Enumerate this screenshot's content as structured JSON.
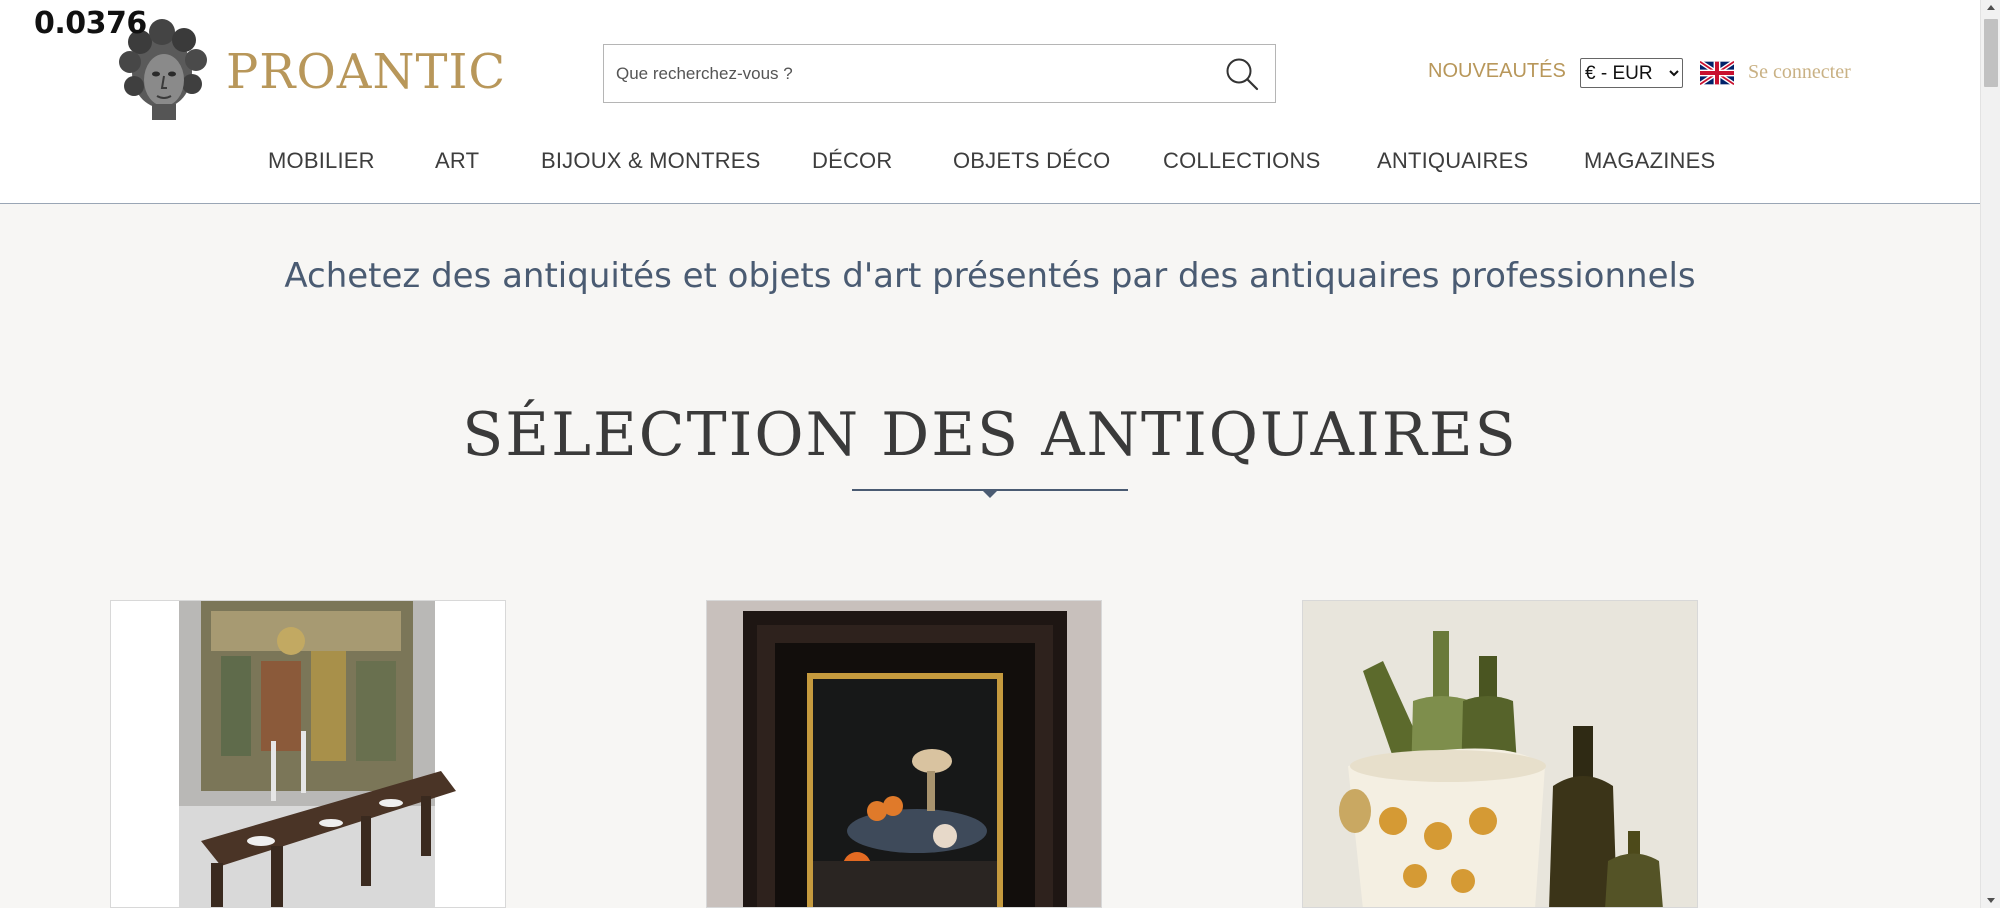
{
  "overlay": {
    "value": "0.0376"
  },
  "brand": {
    "name": "PROANTIC"
  },
  "search": {
    "placeholder": "Que recherchez-vous ?"
  },
  "header": {
    "nouveautes": "NOUVEAUTÉS",
    "currency_selected": "€ - EUR",
    "language_flag": "uk-flag-icon",
    "login": "Se connecter"
  },
  "nav": {
    "items": [
      {
        "label": "MOBILIER"
      },
      {
        "label": "ART"
      },
      {
        "label": "BIJOUX & MONTRES"
      },
      {
        "label": "DÉCOR"
      },
      {
        "label": "OBJETS DÉCO"
      },
      {
        "label": "COLLECTIONS"
      },
      {
        "label": "ANTIQUAIRES"
      },
      {
        "label": "MAGAZINES"
      }
    ]
  },
  "main": {
    "tagline": "Achetez des antiquités et objets d'art présentés par des antiquaires professionnels",
    "section_title": "SÉLECTION DES ANTIQUAIRES"
  },
  "colors": {
    "gold": "#b8975a",
    "tagline_blue": "#4a5b72",
    "background": "#f7f6f4"
  }
}
